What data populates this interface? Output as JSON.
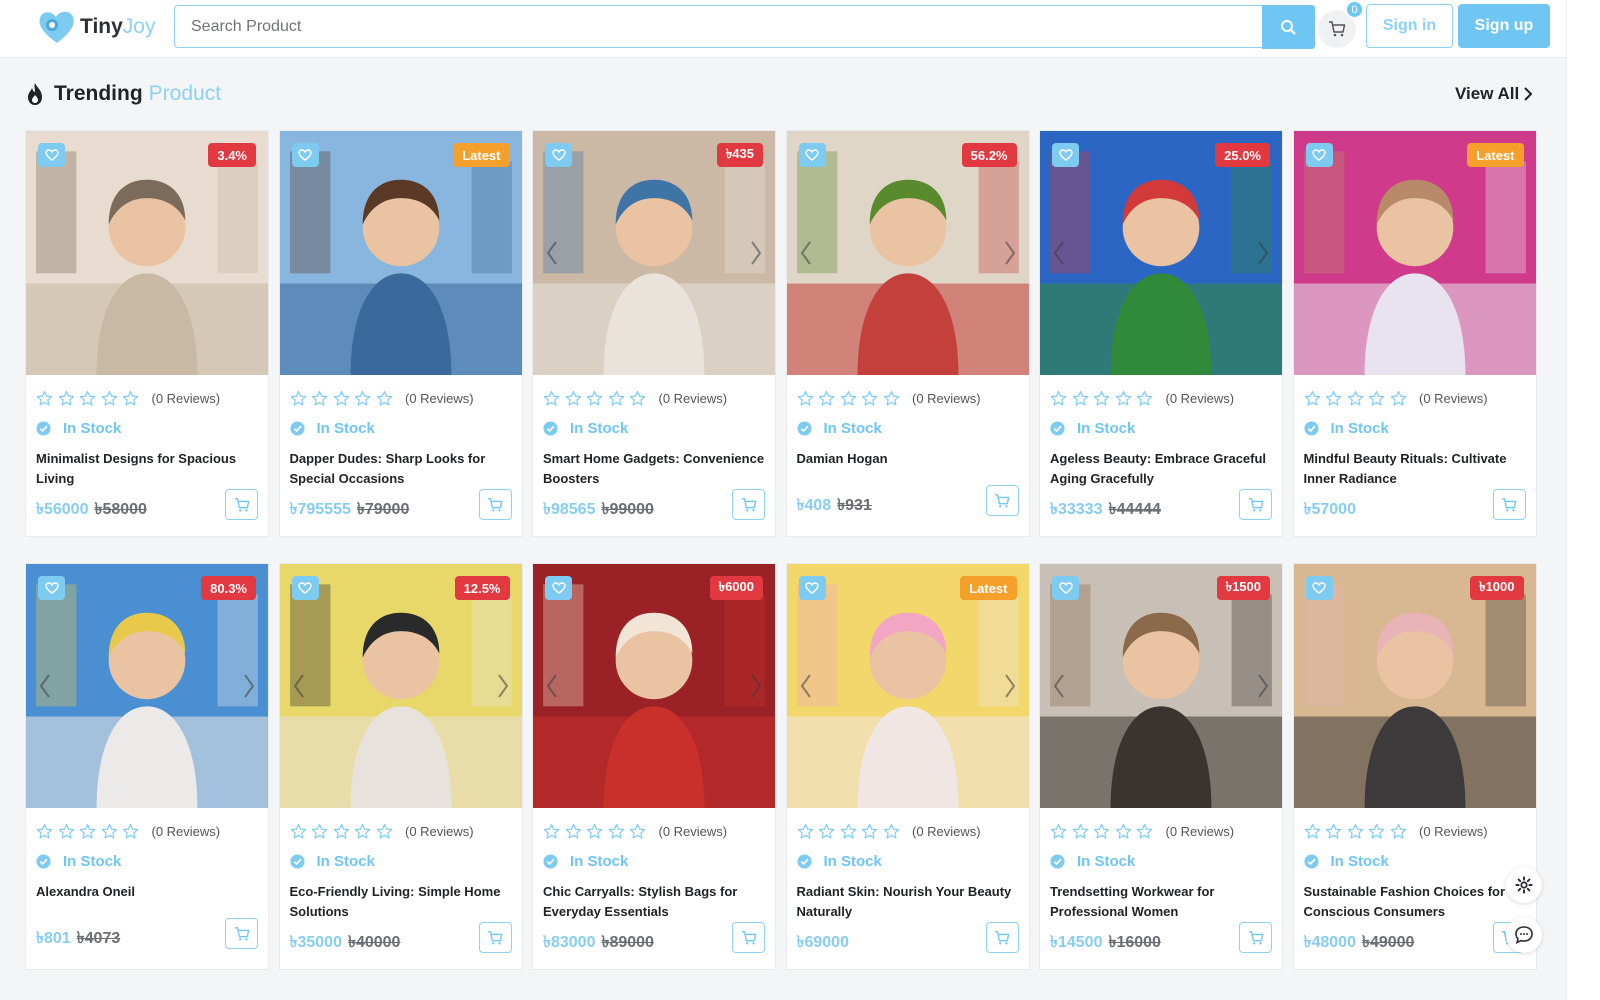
{
  "header": {
    "brand_part1": "Tiny",
    "brand_part2": "Joy",
    "search_placeholder": "Search Product",
    "cart_count": "0",
    "signin_label": "Sign in",
    "signup_label": "Sign up"
  },
  "section": {
    "title_part1": "Trending",
    "title_part2": "Product",
    "view_all_label": "View All"
  },
  "colors": {
    "accent": "#6fc6f3",
    "badge_red": "#e2383f",
    "badge_orange": "#f4a02b"
  },
  "products": [
    {
      "name": "Minimalist Designs for Spacious Living",
      "price": "৳56000",
      "old_price": "৳58000",
      "badge": "3.4%",
      "badge_color": "red",
      "reviews": "(0 Reviews)",
      "stock": "In Stock",
      "scene": [
        "#c9b8a4",
        "#7c6a5a",
        "#e7dccf"
      ]
    },
    {
      "name": "Dapper Dudes: Sharp Looks for Special Occasions",
      "price": "৳795555",
      "old_price": "৳79000",
      "badge": "Latest",
      "badge_color": "orange",
      "reviews": "(0 Reviews)",
      "stock": "In Stock",
      "scene": [
        "#3a6a9c",
        "#5a3a26",
        "#89b6de"
      ]
    },
    {
      "name": "Smart Home Gadgets: Convenience Boosters",
      "price": "৳98565",
      "old_price": "৳99000",
      "badge": "৳435",
      "badge_color": "red",
      "reviews": "(0 Reviews)",
      "stock": "In Stock",
      "scene": [
        "#e9e3dc",
        "#3e74a6",
        "#cbb9a6"
      ]
    },
    {
      "name": "Damian Hogan",
      "price": "৳408",
      "old_price": "৳931",
      "badge": "56.2%",
      "badge_color": "red",
      "reviews": "(0 Reviews)",
      "stock": "In Stock",
      "scene": [
        "#c4403b",
        "#5a8a2e",
        "#e0d6c8"
      ]
    },
    {
      "name": "Ageless Beauty: Embrace Graceful Aging Gracefully",
      "price": "৳33333",
      "old_price": "৳44444",
      "badge": "25.0%",
      "badge_color": "red",
      "reviews": "(0 Reviews)",
      "stock": "In Stock",
      "scene": [
        "#2f8a3a",
        "#d23a3a",
        "#2b66c4"
      ]
    },
    {
      "name": "Mindful Beauty Rituals: Cultivate Inner Radiance",
      "price": "৳57000",
      "old_price": "",
      "badge": "Latest",
      "badge_color": "orange",
      "reviews": "(0 Reviews)",
      "stock": "In Stock",
      "scene": [
        "#e8e3ee",
        "#b98a6a",
        "#cf3b8a"
      ]
    },
    {
      "name": "Alexandra Oneil",
      "price": "৳801",
      "old_price": "৳4073",
      "badge": "80.3%",
      "badge_color": "red",
      "reviews": "(0 Reviews)",
      "stock": "In Stock",
      "scene": [
        "#eceae8",
        "#e9c94a",
        "#4a8fd1"
      ]
    },
    {
      "name": "Eco-Friendly Living: Simple Home Solutions",
      "price": "৳35000",
      "old_price": "৳40000",
      "badge": "12.5%",
      "badge_color": "red",
      "reviews": "(0 Reviews)",
      "stock": "In Stock",
      "scene": [
        "#e8e2dc",
        "#2a2a2a",
        "#e8d86a"
      ]
    },
    {
      "name": "Chic Carryalls: Stylish Bags for Everyday Essentials",
      "price": "৳83000",
      "old_price": "৳89000",
      "badge": "৳6000",
      "badge_color": "red",
      "reviews": "(0 Reviews)",
      "stock": "In Stock",
      "scene": [
        "#c9302c",
        "#f3e5d6",
        "#9a2226"
      ]
    },
    {
      "name": "Radiant Skin: Nourish Your Beauty Naturally",
      "price": "৳69000",
      "old_price": "",
      "badge": "Latest",
      "badge_color": "orange",
      "reviews": "(0 Reviews)",
      "stock": "In Stock",
      "scene": [
        "#f0e6e4",
        "#f2a6c4",
        "#f2d86a"
      ]
    },
    {
      "name": "Trendsetting Workwear for Professional Women",
      "price": "৳14500",
      "old_price": "৳16000",
      "badge": "৳1500",
      "badge_color": "red",
      "reviews": "(0 Reviews)",
      "stock": "In Stock",
      "scene": [
        "#3a3430",
        "#8a6a4a",
        "#c8bfb6"
      ]
    },
    {
      "name": "Sustainable Fashion Choices for Conscious Consumers",
      "price": "৳48000",
      "old_price": "৳49000",
      "badge": "৳1000",
      "badge_color": "red",
      "reviews": "(0 Reviews)",
      "stock": "In Stock",
      "scene": [
        "#3c3a3a",
        "#e8b4b8",
        "#d8b890"
      ]
    }
  ]
}
